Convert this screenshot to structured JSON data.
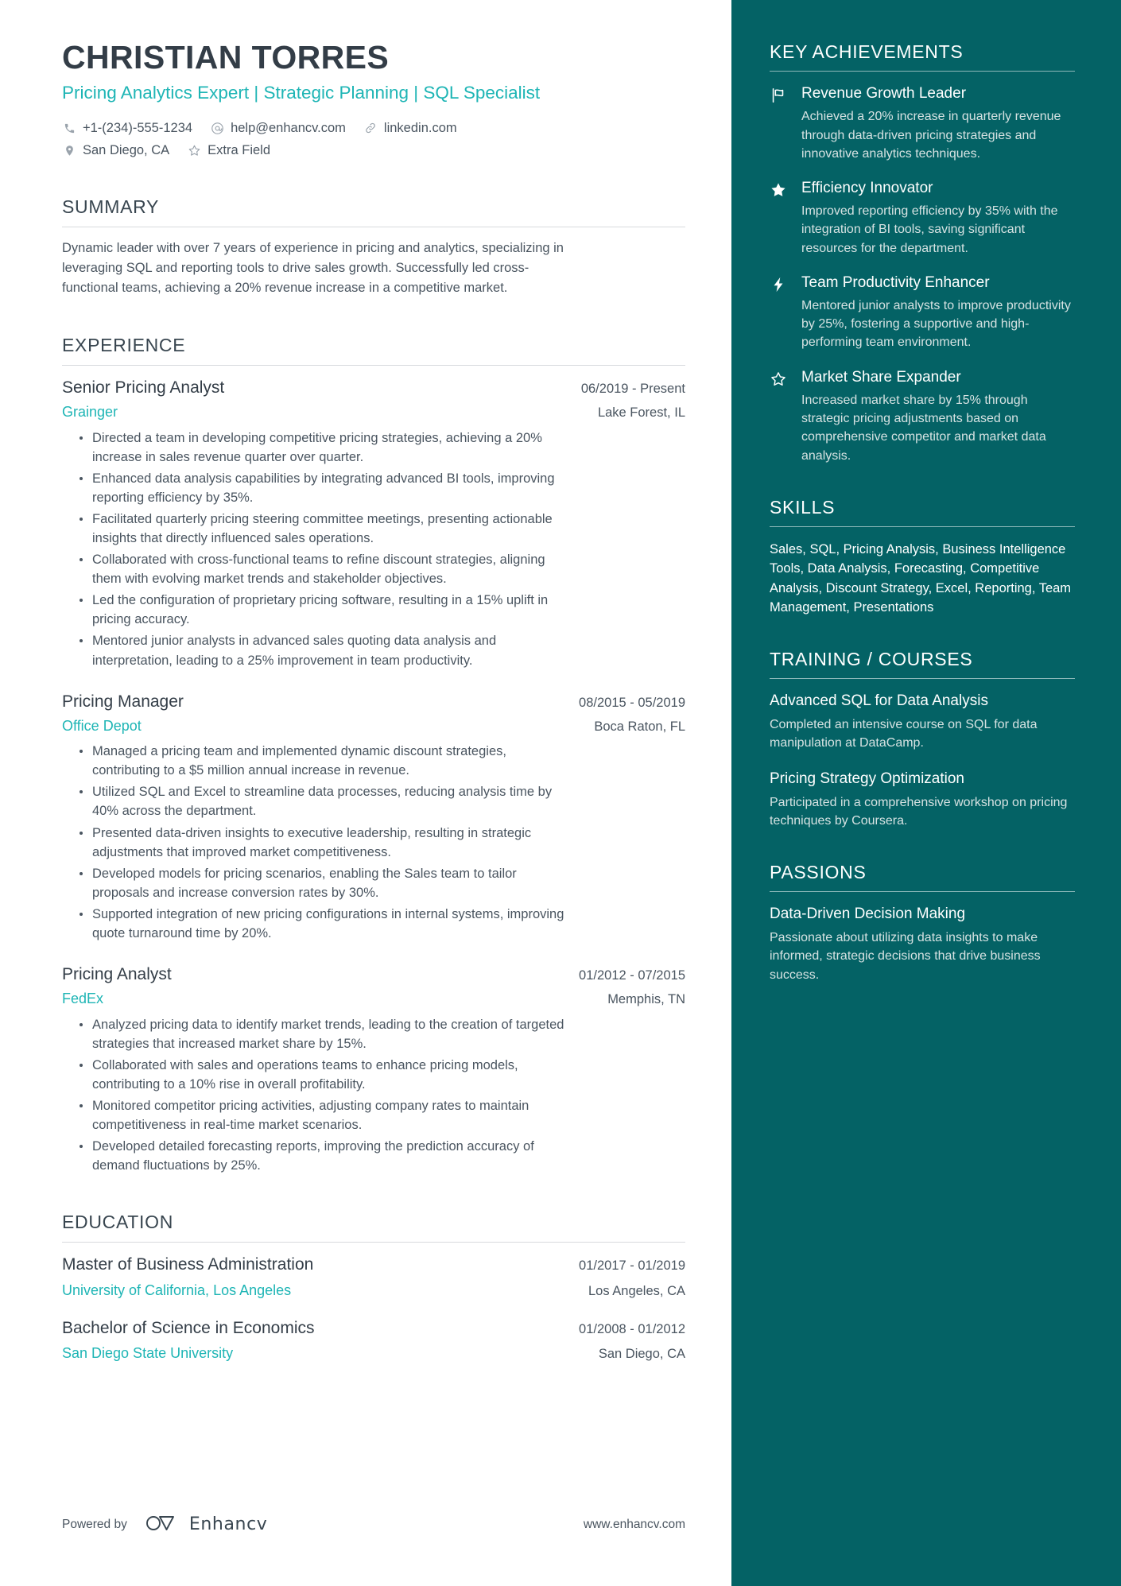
{
  "header": {
    "name": "CHRISTIAN TORRES",
    "headline": "Pricing Analytics Expert | Strategic Planning | SQL Specialist",
    "contacts_row1": [
      {
        "icon": "phone-icon",
        "text": "+1-(234)-555-1234"
      },
      {
        "icon": "email-icon",
        "text": "help@enhancv.com"
      },
      {
        "icon": "link-icon",
        "text": "linkedin.com"
      }
    ],
    "contacts_row2": [
      {
        "icon": "location-pin-icon",
        "text": "San Diego, CA"
      },
      {
        "icon": "star-outline-icon",
        "text": "Extra Field"
      }
    ]
  },
  "summary": {
    "title": "SUMMARY",
    "text": "Dynamic leader with over 7 years of experience in pricing and analytics, specializing in leveraging SQL and reporting tools to drive sales growth. Successfully led cross-functional teams, achieving a 20% revenue increase in a competitive market."
  },
  "experience": {
    "title": "EXPERIENCE",
    "jobs": [
      {
        "title": "Senior Pricing Analyst",
        "dates": "06/2019 - Present",
        "company": "Grainger",
        "location": "Lake Forest, IL",
        "bullets": [
          "Directed a team in developing competitive pricing strategies, achieving a 20% increase in sales revenue quarter over quarter.",
          "Enhanced data analysis capabilities by integrating advanced BI tools, improving reporting efficiency by 35%.",
          "Facilitated quarterly pricing steering committee meetings, presenting actionable insights that directly influenced sales operations.",
          "Collaborated with cross-functional teams to refine discount strategies, aligning them with evolving market trends and stakeholder objectives.",
          "Led the configuration of proprietary pricing software, resulting in a 15% uplift in pricing accuracy.",
          "Mentored junior analysts in advanced sales quoting data analysis and interpretation, leading to a 25% improvement in team productivity."
        ]
      },
      {
        "title": "Pricing Manager",
        "dates": "08/2015 - 05/2019",
        "company": "Office Depot",
        "location": "Boca Raton, FL",
        "bullets": [
          "Managed a pricing team and implemented dynamic discount strategies, contributing to a $5 million annual increase in revenue.",
          "Utilized SQL and Excel to streamline data processes, reducing analysis time by 40% across the department.",
          "Presented data-driven insights to executive leadership, resulting in strategic adjustments that improved market competitiveness.",
          "Developed models for pricing scenarios, enabling the Sales team to tailor proposals and increase conversion rates by 30%.",
          "Supported integration of new pricing configurations in internal systems, improving quote turnaround time by 20%."
        ]
      },
      {
        "title": "Pricing Analyst",
        "dates": "01/2012 - 07/2015",
        "company": "FedEx",
        "location": "Memphis, TN",
        "bullets": [
          "Analyzed pricing data to identify market trends, leading to the creation of targeted strategies that increased market share by 15%.",
          "Collaborated with sales and operations teams to enhance pricing models, contributing to a 10% rise in overall profitability.",
          "Monitored competitor pricing activities, adjusting company rates to maintain competitiveness in real-time market scenarios.",
          "Developed detailed forecasting reports, improving the prediction accuracy of demand fluctuations by 25%."
        ]
      }
    ]
  },
  "education": {
    "title": "EDUCATION",
    "entries": [
      {
        "degree": "Master of Business Administration",
        "dates": "01/2017 - 01/2019",
        "school": "University of California, Los Angeles",
        "location": "Los Angeles, CA"
      },
      {
        "degree": "Bachelor of Science in Economics",
        "dates": "01/2008 - 01/2012",
        "school": "San Diego State University",
        "location": "San Diego, CA"
      }
    ]
  },
  "footer": {
    "powered_by": "Powered by",
    "brand": "Enhancv",
    "url": "www.enhancv.com"
  },
  "sidebar": {
    "achievements": {
      "title": "KEY ACHIEVEMENTS",
      "items": [
        {
          "icon": "flag-icon",
          "title": "Revenue Growth Leader",
          "desc": "Achieved a 20% increase in quarterly revenue through data-driven pricing strategies and innovative analytics techniques."
        },
        {
          "icon": "star-filled-icon",
          "title": "Efficiency Innovator",
          "desc": "Improved reporting efficiency by 35% with the integration of BI tools, saving significant resources for the department."
        },
        {
          "icon": "lightning-bolt-icon",
          "title": "Team Productivity Enhancer",
          "desc": "Mentored junior analysts to improve productivity by 25%, fostering a supportive and high-performing team environment."
        },
        {
          "icon": "star-outline-icon",
          "title": "Market Share Expander",
          "desc": "Increased market share by 15% through strategic pricing adjustments based on comprehensive competitor and market data analysis."
        }
      ]
    },
    "skills": {
      "title": "SKILLS",
      "text": "Sales, SQL, Pricing Analysis, Business Intelligence Tools, Data Analysis, Forecasting, Competitive Analysis, Discount Strategy, Excel, Reporting, Team Management, Presentations"
    },
    "training": {
      "title": "TRAINING / COURSES",
      "items": [
        {
          "title": "Advanced SQL for Data Analysis",
          "desc": "Completed an intensive course on SQL for data manipulation at DataCamp."
        },
        {
          "title": "Pricing Strategy Optimization",
          "desc": "Participated in a comprehensive workshop on pricing techniques by Coursera."
        }
      ]
    },
    "passions": {
      "title": "PASSIONS",
      "items": [
        {
          "title": "Data-Driven Decision Making",
          "desc": "Passionate about utilizing data insights to make informed, strategic decisions that drive business success."
        }
      ]
    }
  },
  "colors": {
    "accent_teal": "#1eb5b5",
    "sidebar_bg": "#046265",
    "heading": "#333d47",
    "body_text": "#4a5560"
  }
}
